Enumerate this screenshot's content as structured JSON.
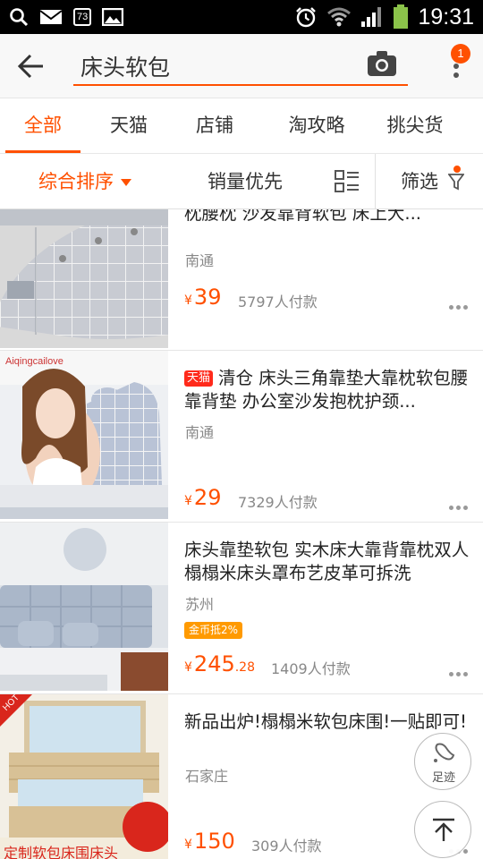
{
  "status_bar": {
    "time": "19:31",
    "notification_count": "73",
    "icons": [
      "search-icon",
      "mail-icon",
      "notification-count-icon",
      "image-icon",
      "alarm-icon",
      "wifi-icon",
      "signal-icon",
      "battery-icon"
    ]
  },
  "search": {
    "query": "床头软包",
    "camera_icon": "camera-icon",
    "back_icon": "arrow-left-icon",
    "more_icon": "more-vertical-icon",
    "more_badge": "1"
  },
  "tabs": [
    {
      "label": "全部",
      "active": true
    },
    {
      "label": "天猫",
      "active": false
    },
    {
      "label": "店铺",
      "active": false
    },
    {
      "label": "淘攻略",
      "active": false
    },
    {
      "label": "挑尖货",
      "active": false
    }
  ],
  "filters": {
    "sort_label": "综合排序",
    "sales_label": "销量优先",
    "layout_icon": "list-layout-icon",
    "filter_label": "筛选",
    "filter_icon": "funnel-icon"
  },
  "products": [
    {
      "title": "双人床头三角靠垫抱枕榻榻米靠枕腰枕 沙发靠背软包 床上大...",
      "tmall": true,
      "location": "南通",
      "price_int": "39",
      "price_dec": "",
      "sold": "5797人付款"
    },
    {
      "title": "清仓 床头三角靠垫大靠枕软包腰靠背垫 办公室沙发抱枕护颈...",
      "tmall": true,
      "tag_label": "天猫",
      "location": "南通",
      "price_int": "29",
      "price_dec": "",
      "sold": "7329人付款"
    },
    {
      "title": "床头靠垫软包 实木床大靠背靠枕双人榻榻米床头罩布艺皮革可拆洗",
      "tmall": false,
      "location": "苏州",
      "coin_badge": "金币抵2%",
      "price_int": "245",
      "price_dec": ".28",
      "sold": "1409人付款"
    },
    {
      "title": "新品出炉!榻榻米软包床围!一贴即可!",
      "tmall": false,
      "location": "石家庄",
      "price_int": "150",
      "price_dec": "",
      "sold": "309人付款"
    }
  ],
  "currency_symbol": "¥",
  "floating": {
    "footprint_label": "足迹",
    "footprint_icon": "footprint-icon",
    "top_icon": "back-to-top-icon"
  },
  "image_text": {
    "brand_watermark": "Aiqingcailove",
    "hot_tag": "HOT",
    "banner_text": "定制软包床围床头"
  },
  "colors": {
    "accent": "#ff5000",
    "tmall_red": "#ff2a1b",
    "coin_orange": "#ff9a00",
    "text_gray": "#888888"
  }
}
